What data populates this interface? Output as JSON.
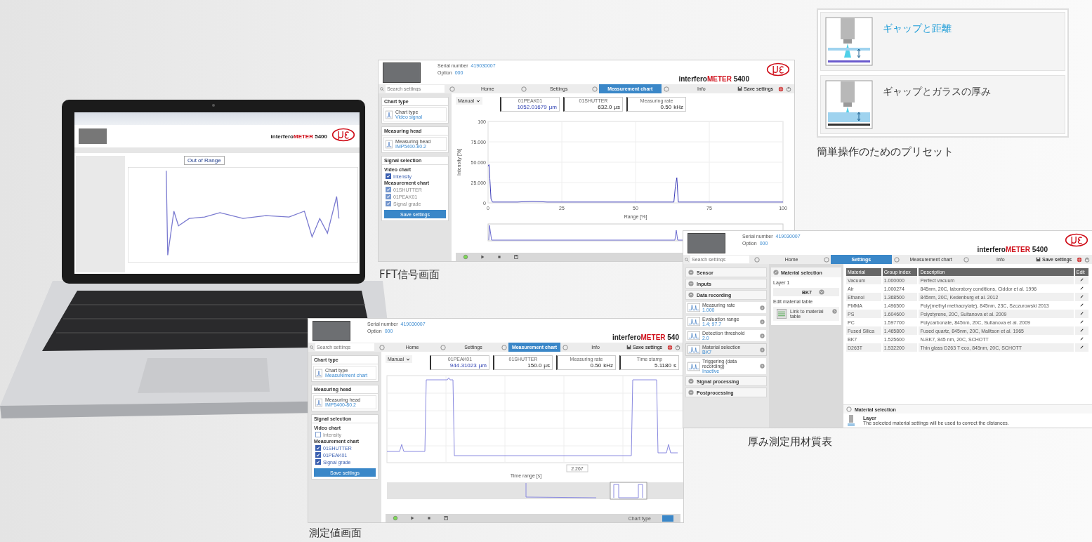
{
  "laptop": {
    "brand_plain": "interfero",
    "brand_accent": "METER",
    "brand_model": "5400",
    "status": "Out of Range"
  },
  "fft_window": {
    "header": {
      "serial_label": "Serial number",
      "serial": "419030007",
      "option_label": "Option",
      "option": "000",
      "brand_plain": "interfero",
      "brand_accent": "METER",
      "brand_model": "5400",
      "logo": true
    },
    "nav": {
      "search_placeholder": "Search settings",
      "tabs": [
        {
          "label": "Home",
          "selected": false
        },
        {
          "label": "Settings",
          "selected": false
        },
        {
          "label": "Measurement chart",
          "selected": true
        },
        {
          "label": "Info",
          "selected": false
        }
      ],
      "save": "Save settings"
    },
    "sidebar": [
      {
        "title": "Chart type",
        "kind": "item",
        "label": "Chart type",
        "value": "Video signal"
      },
      {
        "title": "Measuring head",
        "kind": "item",
        "label": "Measuring head",
        "value": "IMP5400-80.2"
      },
      {
        "title": "Signal selection",
        "kind": "signals",
        "groups": [
          {
            "label": "Video chart",
            "checks": [
              {
                "label": "Intensity",
                "checked": true,
                "disabled": false
              }
            ]
          },
          {
            "label": "Measurement chart",
            "checks": [
              {
                "label": "01SHUTTER",
                "checked": true,
                "disabled": true
              },
              {
                "label": "01PEAK01",
                "checked": true,
                "disabled": true
              },
              {
                "label": "Signal grade",
                "checked": true,
                "disabled": true
              }
            ]
          }
        ],
        "button": "Save settings"
      }
    ],
    "mode": "Manual",
    "readouts": [
      {
        "label": "01PEAK01",
        "value": "1052.01679",
        "unit": "µm",
        "highlighted": true
      },
      {
        "label": "01SHUTTER",
        "value": "632.0",
        "unit": "µs",
        "highlighted": false
      },
      {
        "label": "Measuring rate",
        "value": "0.50",
        "unit": "kHz",
        "highlighted": false
      }
    ],
    "chart_data": {
      "type": "line",
      "xlabel": "Range [%]",
      "ylabel": "Intensity [%]",
      "x": [
        0,
        0.3,
        0.6,
        1,
        1.5,
        5,
        10,
        15,
        20,
        40,
        63,
        63.5,
        64,
        64.5,
        80,
        100
      ],
      "series": [
        {
          "color": "#3b3bb8",
          "values": [
            45,
            47,
            30,
            5,
            1,
            1,
            1,
            2,
            1,
            1,
            1,
            20,
            31,
            1,
            1,
            1
          ]
        }
      ],
      "grid": true,
      "xlim": [
        0,
        100
      ],
      "ylim": [
        0,
        100
      ],
      "xticks": [
        0,
        25,
        50,
        75,
        100
      ],
      "yticks": [
        {
          "value": 100,
          "label": "100"
        },
        {
          "value": 75,
          "label": "75.000"
        },
        {
          "value": 50,
          "label": "50.000"
        },
        {
          "value": 25,
          "label": "25.000"
        },
        {
          "value": 0,
          "label": "0"
        }
      ]
    },
    "caption": "FFT信号画面"
  },
  "measurement_window": {
    "header": {
      "serial_label": "Serial number",
      "serial": "419030007",
      "option_label": "Option",
      "option": "000",
      "brand_plain": "interfero",
      "brand_accent": "METER",
      "brand_model": "540",
      "logo": false
    },
    "nav": {
      "search_placeholder": "Search settings",
      "tabs": [
        {
          "label": "Home",
          "selected": false
        },
        {
          "label": "Settings",
          "selected": false
        },
        {
          "label": "Measurement chart",
          "selected": true
        },
        {
          "label": "Info",
          "selected": false
        }
      ],
      "save": "Save settings"
    },
    "sidebar": [
      {
        "title": "Chart type",
        "kind": "item",
        "label": "Chart type",
        "value": "Measurement chart"
      },
      {
        "title": "Measuring head",
        "kind": "item",
        "label": "Measuring head",
        "value": "IMP5400-80.2"
      },
      {
        "title": "Signal selection",
        "kind": "signals",
        "groups": [
          {
            "label": "Video chart",
            "checks": [
              {
                "label": "Intensity",
                "checked": false,
                "disabled": true
              }
            ]
          },
          {
            "label": "Measurement chart",
            "checks": [
              {
                "label": "01SHUTTER",
                "checked": true,
                "disabled": false
              },
              {
                "label": "01PEAK01",
                "checked": true,
                "disabled": false
              },
              {
                "label": "Signal grade",
                "checked": true,
                "disabled": false
              }
            ]
          }
        ],
        "button": "Save settings"
      }
    ],
    "mode": "Manual",
    "readouts": [
      {
        "label": "01PEAK01",
        "value": "944.31023",
        "unit": "µm",
        "highlighted": true
      },
      {
        "label": "01SHUTTER",
        "value": "150.0",
        "unit": "µs",
        "highlighted": false
      },
      {
        "label": "Measuring rate",
        "value": "0.50",
        "unit": "kHz",
        "highlighted": false
      },
      {
        "label": "Time stamp",
        "value": "5.1180",
        "unit": "s",
        "highlighted": false
      }
    ],
    "axis": {
      "xlabel": "Time range [s]",
      "marker": "2.267"
    },
    "footer_label": "Chart type",
    "footer_toggle": {
      "selected": true
    },
    "caption": "測定値画面"
  },
  "material_window": {
    "header": {
      "serial_label": "Serial number",
      "serial": "419030007",
      "option_label": "Option",
      "option": "000",
      "brand_plain": "interfero",
      "brand_accent": "METER",
      "brand_model": "5400",
      "logo": true
    },
    "nav": {
      "search_placeholder": "Search settings",
      "tabs": [
        {
          "label": "Home",
          "selected": false
        },
        {
          "label": "Settings",
          "selected": true
        },
        {
          "label": "Measurement chart",
          "selected": false
        },
        {
          "label": "Info",
          "selected": false
        }
      ],
      "save": "Save settings"
    },
    "accordion": [
      {
        "title": "Sensor",
        "expanded": false
      },
      {
        "title": "Inputs",
        "expanded": false
      },
      {
        "title": "Data recording",
        "expanded": true,
        "items": [
          {
            "label": "Measuring rate",
            "value": "1.000",
            "selected": false
          },
          {
            "label": "Evaluation range",
            "value": "1.4; 97.7",
            "selected": false
          },
          {
            "label": "Detection threshold",
            "value": "2.0",
            "selected": false
          },
          {
            "label": "Material selection",
            "value": "BK7",
            "selected": true
          },
          {
            "label": "Triggering (data recording)",
            "value": "Inactive",
            "selected": false
          }
        ]
      },
      {
        "title": "Signal processing",
        "expanded": false
      },
      {
        "title": "Postprocessing",
        "expanded": false
      }
    ],
    "material_panel": {
      "title": "Material selection",
      "layer_label": "Layer 1",
      "layer_value": "BK7",
      "edit_label": "Edit material table",
      "link": "Link to material table"
    },
    "table": {
      "columns": [
        "Material",
        "Group index",
        "Description",
        "Edit"
      ],
      "rows": [
        [
          "Vacuum",
          "1.000000",
          "Perfect vacuum"
        ],
        [
          "Air",
          "1.000274",
          "845nm, 20C, laboratory conditions, Ciddor et al. 1996"
        ],
        [
          "Ethanol",
          "1.368500",
          "845nm, 20C, Kedenburg et al. 2012"
        ],
        [
          "PMMA",
          "1.496500",
          "Poly(methyl methacrylate), 845nm, 23C, Szczurowski 2013"
        ],
        [
          "PS",
          "1.604600",
          "Polystyrene, 20C, Sultanova et al. 2009"
        ],
        [
          "PC",
          "1.597700",
          "Polycarbonate, 845nm, 20C, Sultanova et al. 2009"
        ],
        [
          "Fused Silica",
          "1.465800",
          "Fused quartz, 845nm, 20C, Malitson et al. 1965"
        ],
        [
          "BK7",
          "1.525600",
          "N-BK7, 845 nm, 20C, SCHOTT"
        ],
        [
          "D263T",
          "1.532200",
          "Thin glass D263 T eco, 845nm, 20C, SCHOTT"
        ]
      ]
    },
    "info": {
      "title": "Material selection",
      "heading": "Layer",
      "text": "The selected material settings will be used to correct the distances."
    },
    "caption": "厚み測定用材質表"
  },
  "presets": {
    "items": [
      {
        "label": "ギャップと距離",
        "selected": true
      },
      {
        "label": "ギャップとガラスの厚み",
        "selected": false
      }
    ],
    "caption": "簡単操作のためのプリセット"
  }
}
